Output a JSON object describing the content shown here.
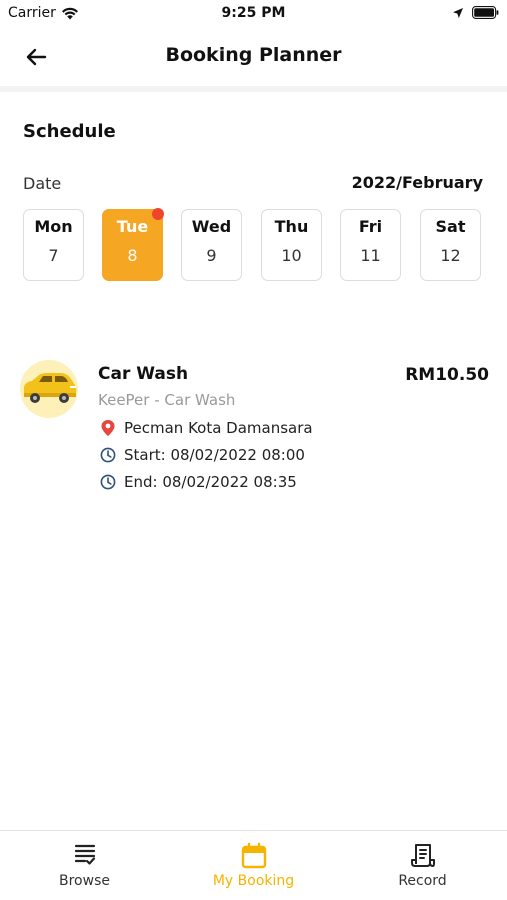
{
  "status_bar": {
    "carrier": "Carrier",
    "time": "9:25 PM"
  },
  "header": {
    "title": "Booking Planner"
  },
  "schedule": {
    "section_title": "Schedule",
    "date_label": "Date",
    "month": "2022/February",
    "selected_index": 1,
    "days": [
      {
        "name": "Mon",
        "num": "7"
      },
      {
        "name": "Tue",
        "num": "8",
        "has_booking": true
      },
      {
        "name": "Wed",
        "num": "9"
      },
      {
        "name": "Thu",
        "num": "10"
      },
      {
        "name": "Fri",
        "num": "11"
      },
      {
        "name": "Sat",
        "num": "12"
      }
    ]
  },
  "booking": {
    "title": "Car Wash",
    "subtitle": "KeePer - Car Wash",
    "price": "RM10.50",
    "location": "Pecman Kota Damansara",
    "start": "Start: 08/02/2022 08:00",
    "end": "End: 08/02/2022 08:35"
  },
  "tabs": [
    {
      "label": "Browse",
      "icon": "list-icon",
      "active": false
    },
    {
      "label": "My Booking",
      "icon": "calendar-icon",
      "active": true
    },
    {
      "label": "Record",
      "icon": "receipt-icon",
      "active": false
    }
  ],
  "colors": {
    "accent": "#f5a623",
    "tab_active": "#f5b400",
    "notification_dot": "#f0452c",
    "location_pin": "#e8453c",
    "clock": "#2c4f7c"
  }
}
